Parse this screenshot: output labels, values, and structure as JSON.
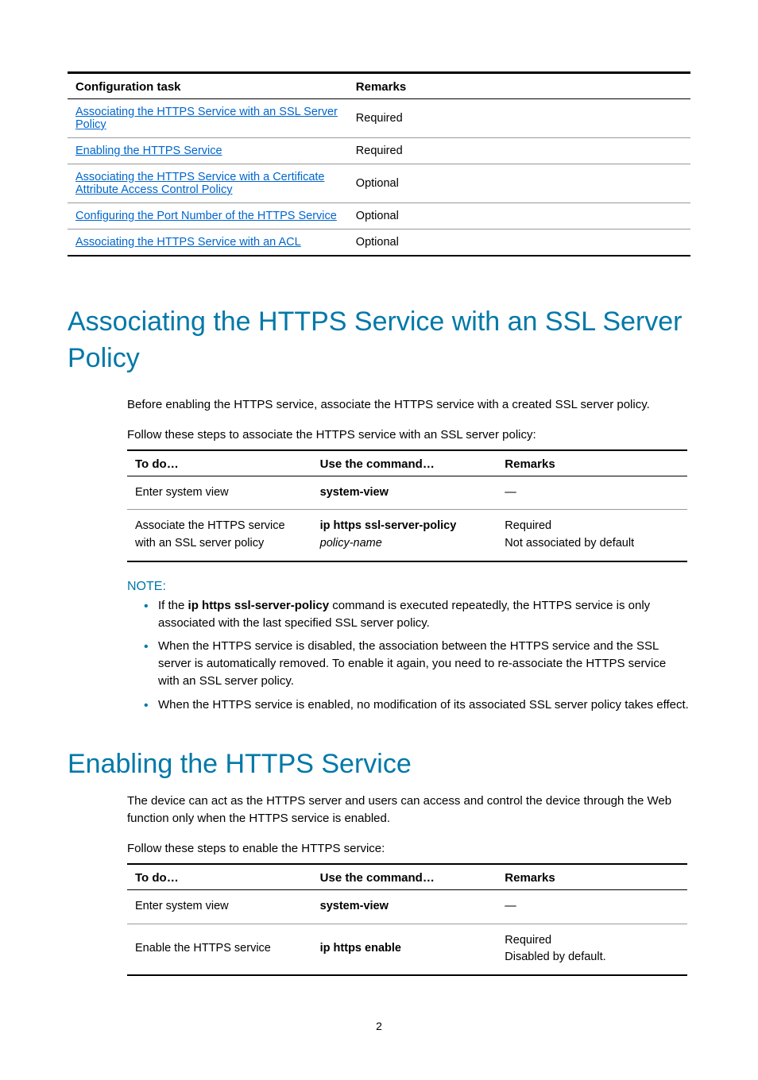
{
  "configTable": {
    "headers": [
      "Configuration task",
      "Remarks"
    ],
    "rows": [
      {
        "task": "Associating the HTTPS Service with an SSL Server Policy",
        "remark": "Required"
      },
      {
        "task": "Enabling the HTTPS Service",
        "remark": "Required"
      },
      {
        "task": "Associating the HTTPS Service with a Certificate Attribute Access Control Policy",
        "remark": "Optional"
      },
      {
        "task": "Configuring the Port Number of the HTTPS Service",
        "remark": "Optional"
      },
      {
        "task": "Associating the HTTPS Service with an ACL",
        "remark": "Optional"
      }
    ]
  },
  "section1": {
    "heading": "Associating the HTTPS Service with an SSL Server Policy",
    "intro": "Before enabling the HTTPS service, associate the HTTPS service with a created SSL server policy.",
    "stepsIntro": "Follow these steps to associate the HTTPS service with an SSL server policy:",
    "table": {
      "headers": [
        "To do…",
        "Use the command…",
        "Remarks"
      ],
      "rows": [
        {
          "todo": "Enter system view",
          "cmdBold": "system-view",
          "cmdItalic": "",
          "remark": "—"
        },
        {
          "todo": "Associate the HTTPS service with an SSL server policy",
          "cmdBold": "ip https ssl-server-policy",
          "cmdItalic": "policy-name",
          "remark": "Required\nNot associated by default"
        }
      ]
    },
    "noteLabel": "NOTE:",
    "notes": [
      {
        "prefix": "If the ",
        "bold": "ip https ssl-server-policy",
        "suffix": " command is executed repeatedly, the HTTPS service is only associated with the last specified SSL server policy."
      },
      {
        "text": "When the HTTPS service is disabled, the association between the HTTPS service and the SSL server is automatically removed. To enable it again, you need to re-associate the HTTPS service with an SSL server policy."
      },
      {
        "text": "When the HTTPS service is enabled, no modification of its associated SSL server policy takes effect."
      }
    ]
  },
  "section2": {
    "heading": "Enabling the HTTPS Service",
    "intro": "The device can act as the HTTPS server and users can access and control the device through the Web function only when the HTTPS service is enabled.",
    "stepsIntro": "Follow these steps to enable the HTTPS service:",
    "table": {
      "headers": [
        "To do…",
        "Use the command…",
        "Remarks"
      ],
      "rows": [
        {
          "todo": "Enter system view",
          "cmdBold": "system-view",
          "remark": "—"
        },
        {
          "todo": "Enable the HTTPS service",
          "cmdBold": "ip https enable",
          "remark": "Required\nDisabled by default."
        }
      ]
    }
  },
  "pageNumber": "2"
}
